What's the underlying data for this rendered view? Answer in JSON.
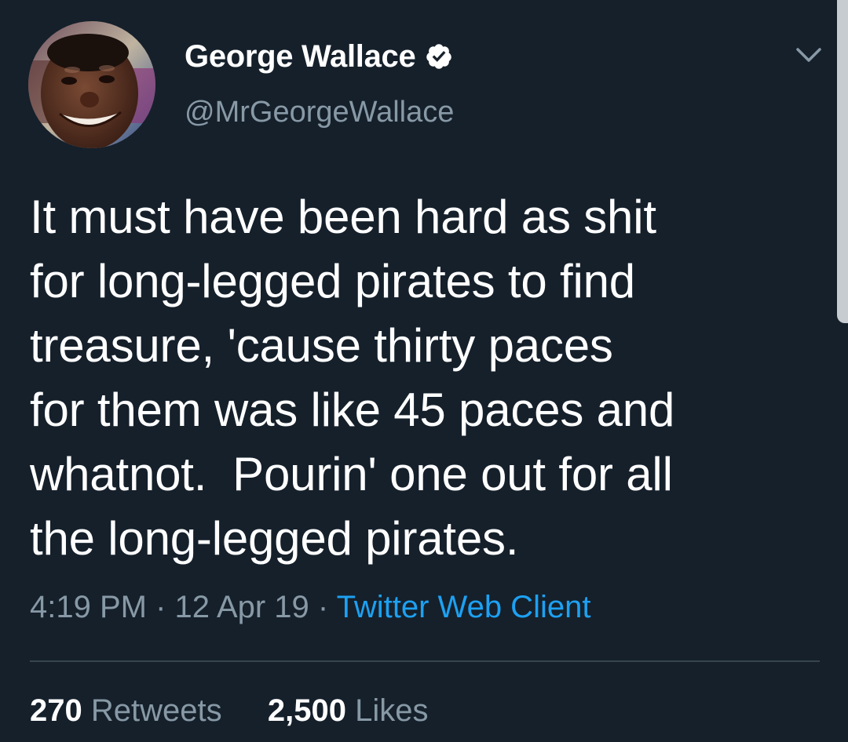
{
  "tweet": {
    "author": {
      "display_name": "George Wallace",
      "handle": "@MrGeorgeWallace",
      "verified": true,
      "avatar_icon": "profile-photo"
    },
    "text": "It must have been hard as shit\nfor long-legged pirates to find\ntreasure, 'cause thirty paces\nfor them was like 45 paces and\nwhatnot.  Pourin' one out for all\nthe long-legged pirates.",
    "time": "4:19 PM",
    "separator": "·",
    "date": "12 Apr 19",
    "client": "Twitter Web Client",
    "stats": {
      "retweets_count": "270",
      "retweets_label": "Retweets",
      "likes_count": "2,500",
      "likes_label": "Likes"
    }
  },
  "icons": {
    "verified": "verified-badge-icon",
    "menu": "chevron-down-icon"
  },
  "colors": {
    "background": "#15202b",
    "text_primary": "#ffffff",
    "text_secondary": "#8899a6",
    "accent": "#1da1f2",
    "divider": "#38444d"
  }
}
